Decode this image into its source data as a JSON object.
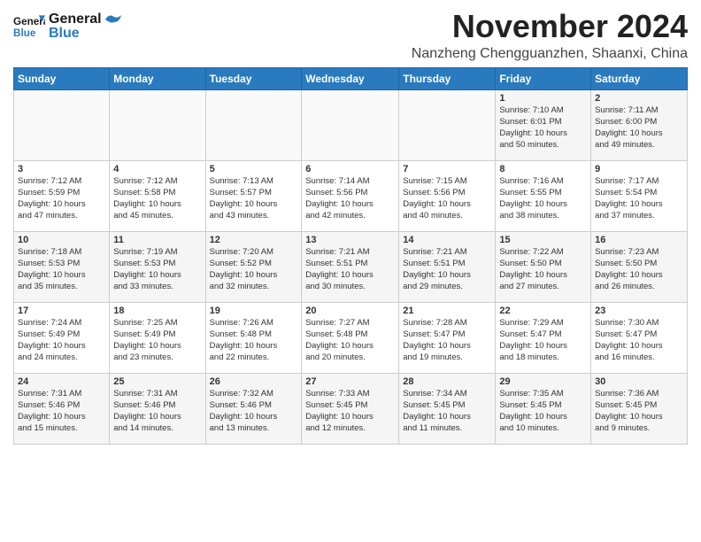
{
  "header": {
    "logo_line1": "General",
    "logo_line2": "Blue",
    "month": "November 2024",
    "location": "Nanzheng Chengguanzhen, Shaanxi, China"
  },
  "weekdays": [
    "Sunday",
    "Monday",
    "Tuesday",
    "Wednesday",
    "Thursday",
    "Friday",
    "Saturday"
  ],
  "weeks": [
    [
      {
        "day": "",
        "info": ""
      },
      {
        "day": "",
        "info": ""
      },
      {
        "day": "",
        "info": ""
      },
      {
        "day": "",
        "info": ""
      },
      {
        "day": "",
        "info": ""
      },
      {
        "day": "1",
        "info": "Sunrise: 7:10 AM\nSunset: 6:01 PM\nDaylight: 10 hours\nand 50 minutes."
      },
      {
        "day": "2",
        "info": "Sunrise: 7:11 AM\nSunset: 6:00 PM\nDaylight: 10 hours\nand 49 minutes."
      }
    ],
    [
      {
        "day": "3",
        "info": "Sunrise: 7:12 AM\nSunset: 5:59 PM\nDaylight: 10 hours\nand 47 minutes."
      },
      {
        "day": "4",
        "info": "Sunrise: 7:12 AM\nSunset: 5:58 PM\nDaylight: 10 hours\nand 45 minutes."
      },
      {
        "day": "5",
        "info": "Sunrise: 7:13 AM\nSunset: 5:57 PM\nDaylight: 10 hours\nand 43 minutes."
      },
      {
        "day": "6",
        "info": "Sunrise: 7:14 AM\nSunset: 5:56 PM\nDaylight: 10 hours\nand 42 minutes."
      },
      {
        "day": "7",
        "info": "Sunrise: 7:15 AM\nSunset: 5:56 PM\nDaylight: 10 hours\nand 40 minutes."
      },
      {
        "day": "8",
        "info": "Sunrise: 7:16 AM\nSunset: 5:55 PM\nDaylight: 10 hours\nand 38 minutes."
      },
      {
        "day": "9",
        "info": "Sunrise: 7:17 AM\nSunset: 5:54 PM\nDaylight: 10 hours\nand 37 minutes."
      }
    ],
    [
      {
        "day": "10",
        "info": "Sunrise: 7:18 AM\nSunset: 5:53 PM\nDaylight: 10 hours\nand 35 minutes."
      },
      {
        "day": "11",
        "info": "Sunrise: 7:19 AM\nSunset: 5:53 PM\nDaylight: 10 hours\nand 33 minutes."
      },
      {
        "day": "12",
        "info": "Sunrise: 7:20 AM\nSunset: 5:52 PM\nDaylight: 10 hours\nand 32 minutes."
      },
      {
        "day": "13",
        "info": "Sunrise: 7:21 AM\nSunset: 5:51 PM\nDaylight: 10 hours\nand 30 minutes."
      },
      {
        "day": "14",
        "info": "Sunrise: 7:21 AM\nSunset: 5:51 PM\nDaylight: 10 hours\nand 29 minutes."
      },
      {
        "day": "15",
        "info": "Sunrise: 7:22 AM\nSunset: 5:50 PM\nDaylight: 10 hours\nand 27 minutes."
      },
      {
        "day": "16",
        "info": "Sunrise: 7:23 AM\nSunset: 5:50 PM\nDaylight: 10 hours\nand 26 minutes."
      }
    ],
    [
      {
        "day": "17",
        "info": "Sunrise: 7:24 AM\nSunset: 5:49 PM\nDaylight: 10 hours\nand 24 minutes."
      },
      {
        "day": "18",
        "info": "Sunrise: 7:25 AM\nSunset: 5:49 PM\nDaylight: 10 hours\nand 23 minutes."
      },
      {
        "day": "19",
        "info": "Sunrise: 7:26 AM\nSunset: 5:48 PM\nDaylight: 10 hours\nand 22 minutes."
      },
      {
        "day": "20",
        "info": "Sunrise: 7:27 AM\nSunset: 5:48 PM\nDaylight: 10 hours\nand 20 minutes."
      },
      {
        "day": "21",
        "info": "Sunrise: 7:28 AM\nSunset: 5:47 PM\nDaylight: 10 hours\nand 19 minutes."
      },
      {
        "day": "22",
        "info": "Sunrise: 7:29 AM\nSunset: 5:47 PM\nDaylight: 10 hours\nand 18 minutes."
      },
      {
        "day": "23",
        "info": "Sunrise: 7:30 AM\nSunset: 5:47 PM\nDaylight: 10 hours\nand 16 minutes."
      }
    ],
    [
      {
        "day": "24",
        "info": "Sunrise: 7:31 AM\nSunset: 5:46 PM\nDaylight: 10 hours\nand 15 minutes."
      },
      {
        "day": "25",
        "info": "Sunrise: 7:31 AM\nSunset: 5:46 PM\nDaylight: 10 hours\nand 14 minutes."
      },
      {
        "day": "26",
        "info": "Sunrise: 7:32 AM\nSunset: 5:46 PM\nDaylight: 10 hours\nand 13 minutes."
      },
      {
        "day": "27",
        "info": "Sunrise: 7:33 AM\nSunset: 5:45 PM\nDaylight: 10 hours\nand 12 minutes."
      },
      {
        "day": "28",
        "info": "Sunrise: 7:34 AM\nSunset: 5:45 PM\nDaylight: 10 hours\nand 11 minutes."
      },
      {
        "day": "29",
        "info": "Sunrise: 7:35 AM\nSunset: 5:45 PM\nDaylight: 10 hours\nand 10 minutes."
      },
      {
        "day": "30",
        "info": "Sunrise: 7:36 AM\nSunset: 5:45 PM\nDaylight: 10 hours\nand 9 minutes."
      }
    ]
  ]
}
